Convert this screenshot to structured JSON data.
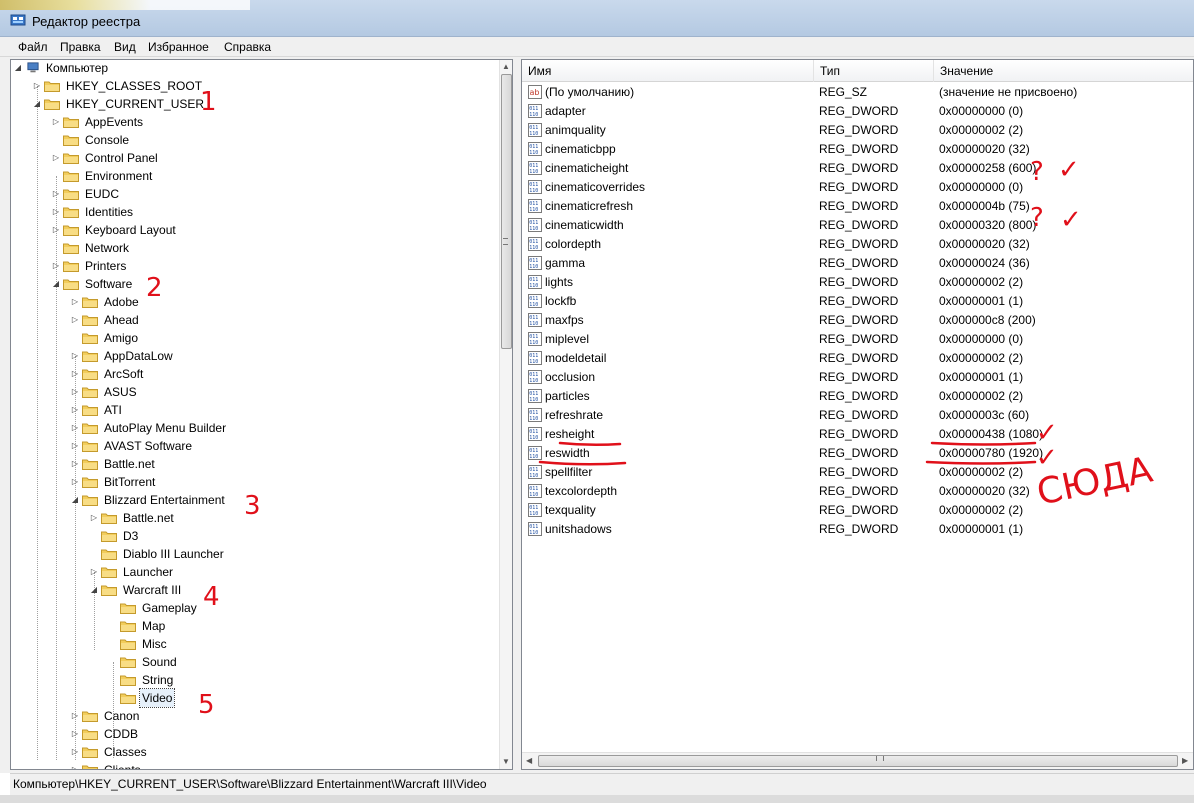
{
  "window": {
    "title": "Редактор реестра"
  },
  "menu": [
    "Файл",
    "Правка",
    "Вид",
    "Избранное",
    "Справка"
  ],
  "tree": {
    "nodes": [
      {
        "label": "Компьютер",
        "depth": 0,
        "expanded": true,
        "icon": "computer-icon"
      },
      {
        "label": "HKEY_CLASSES_ROOT",
        "depth": 1,
        "expanded": false
      },
      {
        "label": "HKEY_CURRENT_USER",
        "depth": 1,
        "expanded": true
      },
      {
        "label": "AppEvents",
        "depth": 2,
        "expanded": false
      },
      {
        "label": "Console",
        "depth": 2
      },
      {
        "label": "Control Panel",
        "depth": 2,
        "expanded": false
      },
      {
        "label": "Environment",
        "depth": 2
      },
      {
        "label": "EUDC",
        "depth": 2,
        "expanded": false
      },
      {
        "label": "Identities",
        "depth": 2,
        "expanded": false
      },
      {
        "label": "Keyboard Layout",
        "depth": 2,
        "expanded": false
      },
      {
        "label": "Network",
        "depth": 2
      },
      {
        "label": "Printers",
        "depth": 2,
        "expanded": false
      },
      {
        "label": "Software",
        "depth": 2,
        "expanded": true
      },
      {
        "label": "Adobe",
        "depth": 3,
        "expanded": false
      },
      {
        "label": "Ahead",
        "depth": 3,
        "expanded": false
      },
      {
        "label": "Amigo",
        "depth": 3
      },
      {
        "label": "AppDataLow",
        "depth": 3,
        "expanded": false
      },
      {
        "label": "ArcSoft",
        "depth": 3,
        "expanded": false
      },
      {
        "label": "ASUS",
        "depth": 3,
        "expanded": false
      },
      {
        "label": "ATI",
        "depth": 3,
        "expanded": false
      },
      {
        "label": "AutoPlay Menu Builder",
        "depth": 3,
        "expanded": false
      },
      {
        "label": "AVAST Software",
        "depth": 3,
        "expanded": false
      },
      {
        "label": "Battle.net",
        "depth": 3,
        "expanded": false
      },
      {
        "label": "BitTorrent",
        "depth": 3,
        "expanded": false
      },
      {
        "label": "Blizzard Entertainment",
        "depth": 3,
        "expanded": true
      },
      {
        "label": "Battle.net",
        "depth": 4,
        "expanded": false
      },
      {
        "label": "D3",
        "depth": 4
      },
      {
        "label": "Diablo III Launcher",
        "depth": 4
      },
      {
        "label": "Launcher",
        "depth": 4,
        "expanded": false
      },
      {
        "label": "Warcraft III",
        "depth": 4,
        "expanded": true
      },
      {
        "label": "Gameplay",
        "depth": 5
      },
      {
        "label": "Map",
        "depth": 5
      },
      {
        "label": "Misc",
        "depth": 5
      },
      {
        "label": "Sound",
        "depth": 5
      },
      {
        "label": "String",
        "depth": 5
      },
      {
        "label": "Video",
        "depth": 5,
        "selected": true
      },
      {
        "label": "Canon",
        "depth": 3,
        "expanded": false
      },
      {
        "label": "CDDB",
        "depth": 3,
        "expanded": false
      },
      {
        "label": "Classes",
        "depth": 3,
        "expanded": false
      },
      {
        "label": "Clients",
        "depth": 3,
        "expanded": false
      }
    ]
  },
  "list": {
    "columns": [
      "Имя",
      "Тип",
      "Значение"
    ],
    "rows": [
      {
        "name": "(По умолчанию)",
        "type": "REG_SZ",
        "value": "(значение не присвоено)",
        "icon": "string-value-icon"
      },
      {
        "name": "adapter",
        "type": "REG_DWORD",
        "value": "0x00000000 (0)",
        "icon": "dword-value-icon"
      },
      {
        "name": "animquality",
        "type": "REG_DWORD",
        "value": "0x00000002 (2)",
        "icon": "dword-value-icon"
      },
      {
        "name": "cinematicbpp",
        "type": "REG_DWORD",
        "value": "0x00000020 (32)",
        "icon": "dword-value-icon"
      },
      {
        "name": "cinematicheight",
        "type": "REG_DWORD",
        "value": "0x00000258 (600)",
        "icon": "dword-value-icon"
      },
      {
        "name": "cinematicoverrides",
        "type": "REG_DWORD",
        "value": "0x00000000 (0)",
        "icon": "dword-value-icon"
      },
      {
        "name": "cinematicrefresh",
        "type": "REG_DWORD",
        "value": "0x0000004b (75)",
        "icon": "dword-value-icon"
      },
      {
        "name": "cinematicwidth",
        "type": "REG_DWORD",
        "value": "0x00000320 (800)",
        "icon": "dword-value-icon"
      },
      {
        "name": "colordepth",
        "type": "REG_DWORD",
        "value": "0x00000020 (32)",
        "icon": "dword-value-icon"
      },
      {
        "name": "gamma",
        "type": "REG_DWORD",
        "value": "0x00000024 (36)",
        "icon": "dword-value-icon"
      },
      {
        "name": "lights",
        "type": "REG_DWORD",
        "value": "0x00000002 (2)",
        "icon": "dword-value-icon"
      },
      {
        "name": "lockfb",
        "type": "REG_DWORD",
        "value": "0x00000001 (1)",
        "icon": "dword-value-icon"
      },
      {
        "name": "maxfps",
        "type": "REG_DWORD",
        "value": "0x000000c8 (200)",
        "icon": "dword-value-icon"
      },
      {
        "name": "miplevel",
        "type": "REG_DWORD",
        "value": "0x00000000 (0)",
        "icon": "dword-value-icon"
      },
      {
        "name": "modeldetail",
        "type": "REG_DWORD",
        "value": "0x00000002 (2)",
        "icon": "dword-value-icon"
      },
      {
        "name": "occlusion",
        "type": "REG_DWORD",
        "value": "0x00000001 (1)",
        "icon": "dword-value-icon"
      },
      {
        "name": "particles",
        "type": "REG_DWORD",
        "value": "0x00000002 (2)",
        "icon": "dword-value-icon"
      },
      {
        "name": "refreshrate",
        "type": "REG_DWORD",
        "value": "0x0000003c (60)",
        "icon": "dword-value-icon"
      },
      {
        "name": "resheight",
        "type": "REG_DWORD",
        "value": "0x00000438 (1080)",
        "icon": "dword-value-icon"
      },
      {
        "name": "reswidth",
        "type": "REG_DWORD",
        "value": "0x00000780 (1920)",
        "icon": "dword-value-icon"
      },
      {
        "name": "spellfilter",
        "type": "REG_DWORD",
        "value": "0x00000002 (2)",
        "icon": "dword-value-icon"
      },
      {
        "name": "texcolordepth",
        "type": "REG_DWORD",
        "value": "0x00000020 (32)",
        "icon": "dword-value-icon"
      },
      {
        "name": "texquality",
        "type": "REG_DWORD",
        "value": "0x00000002 (2)",
        "icon": "dword-value-icon"
      },
      {
        "name": "unitshadows",
        "type": "REG_DWORD",
        "value": "0x00000001 (1)",
        "icon": "dword-value-icon"
      }
    ]
  },
  "statusbar": {
    "path": "Компьютер\\HKEY_CURRENT_USER\\Software\\Blizzard Entertainment\\Warcraft III\\Video"
  },
  "annotations": {
    "color": "#e0101a",
    "step_numbers": [
      "1",
      "2",
      "3",
      "4",
      "5"
    ],
    "question_mark": "?",
    "check_mark": "✓",
    "here_text": "СЮДА"
  },
  "colors": {
    "titlebar": "#c9d9ec",
    "selection": "#e6f0fa",
    "folder": "#f2cd5c"
  }
}
